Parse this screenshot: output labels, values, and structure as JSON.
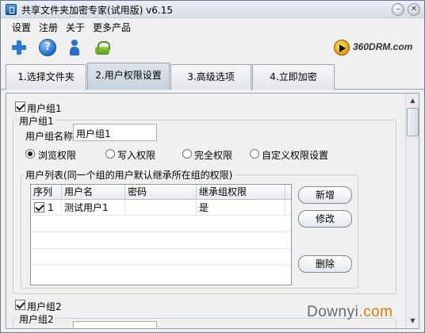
{
  "window": {
    "title": "共享文件夹加密专家(试用版) v6.15",
    "minimize_glyph": "–",
    "close_glyph": "✕"
  },
  "menu": [
    "设置",
    "注册",
    "关于",
    "更多产品"
  ],
  "toolbar": {
    "icons": [
      "plus-icon",
      "help-icon",
      "user-icon",
      "basket-icon"
    ],
    "help_glyph": "?",
    "logo_text": "360DRM.com"
  },
  "tabs": [
    {
      "label": "1.选择文件夹",
      "active": false
    },
    {
      "label": "2.用户权限设置",
      "active": true
    },
    {
      "label": "3.高级选项",
      "active": false
    },
    {
      "label": "4.立即加密",
      "active": false
    }
  ],
  "group1": {
    "checkbox_label": "用户组1",
    "checked": true,
    "box_title": "用户组1",
    "name_label": "用户组名称",
    "name_value": "用户组1",
    "radios": [
      {
        "label": "浏览权限",
        "selected": true
      },
      {
        "label": "写入权限",
        "selected": false
      },
      {
        "label": "完全权限",
        "selected": false
      },
      {
        "label": "自定义权限设置",
        "selected": false
      }
    ],
    "user_list_title": "用户列表(同一个组的用户默认继承所在组的权限)",
    "columns": [
      "序列",
      "用户名",
      "密码",
      "继承组权限"
    ],
    "rows": [
      {
        "checked": true,
        "index": "1",
        "username": "测试用户1",
        "password": "",
        "inherit": "是"
      }
    ],
    "buttons": {
      "add": "新增",
      "edit": "修改",
      "delete": "删除"
    }
  },
  "group2": {
    "checkbox_label": "用户组2",
    "checked": true,
    "box_title": "用户组2"
  },
  "scrollbar": {
    "up": "▲",
    "down": "▼"
  },
  "watermark": {
    "main": "Downyi",
    "suffix": ".com"
  }
}
